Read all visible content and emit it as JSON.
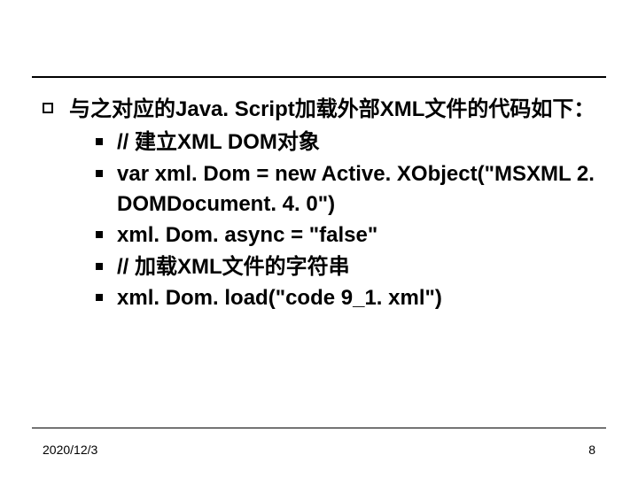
{
  "content": {
    "intro": "与之对应的Java. Script加载外部XML文件的代码如下：",
    "code_lines": [
      "// 建立XML DOM对象",
      "var xml. Dom = new Active. XObject(\"MSXML 2. DOMDocument. 4. 0\")",
      "xml. Dom. async = \"false\"",
      "// 加载XML文件的字符串",
      "xml. Dom. load(\"code 9_1. xml\")"
    ]
  },
  "footer": {
    "date": "2020/12/3",
    "page_number": "8"
  }
}
